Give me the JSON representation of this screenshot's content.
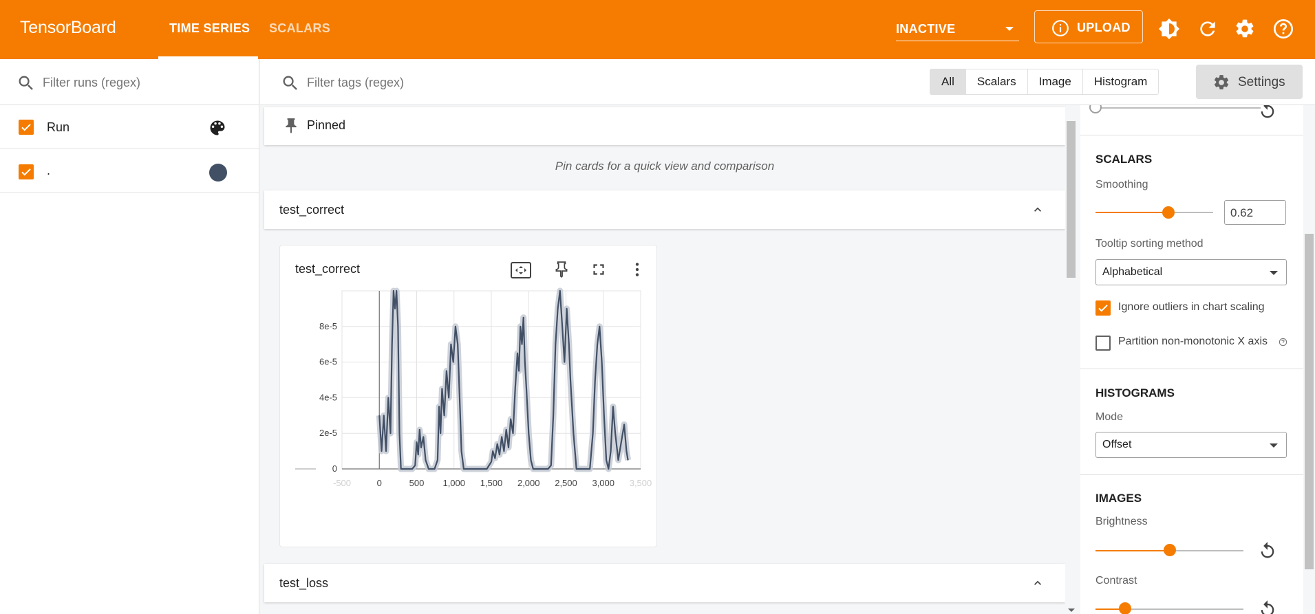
{
  "app": {
    "title": "TensorBoard",
    "accent": "#f57c00"
  },
  "nav": {
    "tabs": [
      {
        "label": "TIME SERIES",
        "active": true
      },
      {
        "label": "SCALARS",
        "active": false
      }
    ],
    "run_status": "INACTIVE",
    "upload_label": "UPLOAD",
    "icons": [
      "theme-icon",
      "reload-icon",
      "settings-icon",
      "help-icon"
    ]
  },
  "runs": {
    "filter_placeholder": "Filter runs (regex)",
    "items": [
      {
        "label": "Run",
        "checked": true,
        "icon": "palette-icon"
      },
      {
        "label": ".",
        "checked": true,
        "color": "#425066"
      }
    ]
  },
  "main": {
    "filter_placeholder": "Filter tags (regex)",
    "type_filters": [
      "All",
      "Scalars",
      "Image",
      "Histogram"
    ],
    "type_selected": "All",
    "settings_label": "Settings",
    "pinned": {
      "title": "Pinned",
      "empty_text": "Pin cards for a quick view and comparison"
    },
    "groups": [
      {
        "title": "test_correct",
        "expanded": true
      },
      {
        "title": "test_loss",
        "expanded": true
      }
    ]
  },
  "card": {
    "title": "test_correct",
    "icons": [
      "fit-domain-icon",
      "pin-icon",
      "fullscreen-icon",
      "more-vert-icon"
    ]
  },
  "chart_data": {
    "type": "line",
    "title": "test_correct",
    "xlabel": "",
    "ylabel": "",
    "x_ticks": [
      "0",
      "500",
      "1,000",
      "1,500",
      "2,000",
      "2,500",
      "3,000"
    ],
    "x_ticks_faded": [
      "-500",
      "3,500"
    ],
    "y_ticks": [
      "0",
      "2e-5",
      "4e-5",
      "6e-5",
      "8e-5"
    ],
    "xlim": [
      -500,
      3500
    ],
    "ylim": [
      0,
      0.0001
    ],
    "grid": true,
    "series": [
      {
        "smoothed": true,
        "color": "#425066",
        "x": [
          0,
          30,
          60,
          90,
          120,
          150,
          170,
          190,
          210,
          230,
          250,
          270,
          290,
          300,
          320,
          360,
          400,
          440,
          480,
          500,
          520,
          540,
          560,
          590,
          620,
          660,
          700,
          740,
          780,
          800,
          820,
          840,
          870,
          900,
          930,
          960,
          990,
          1020,
          1050,
          1080,
          1100,
          1130,
          1160,
          1200,
          1260,
          1320,
          1380,
          1440,
          1500,
          1520,
          1550,
          1580,
          1610,
          1640,
          1670,
          1700,
          1730,
          1760,
          1790,
          1820,
          1850,
          1870,
          1890,
          1910,
          1930,
          1950,
          1970,
          2000,
          2030,
          2060,
          2100,
          2160,
          2220,
          2260,
          2300,
          2330,
          2360,
          2390,
          2420,
          2450,
          2480,
          2510,
          2540,
          2560,
          2600,
          2640,
          2680,
          2720,
          2770,
          2820,
          2860,
          2890,
          2920,
          2950,
          2980,
          3010,
          3040,
          3070,
          3100,
          3130,
          3160,
          3200,
          3240,
          3280,
          3310,
          3330
        ],
        "y": [
          3e-05,
          1e-05,
          3e-05,
          1e-05,
          4e-05,
          2e-05,
          7e-05,
          0.0001,
          9e-05,
          0.0001,
          8e-05,
          2e-05,
          0,
          0,
          0,
          0,
          0,
          0,
          2e-06,
          1.5e-05,
          8e-06,
          2.2e-05,
          1.2e-05,
          1.8e-05,
          5e-06,
          0,
          0,
          0,
          5e-06,
          3.5e-05,
          2e-05,
          4.5e-05,
          3e-05,
          5.5e-05,
          4e-05,
          7e-05,
          6e-05,
          8e-05,
          7e-05,
          3.5e-05,
          1e-05,
          0,
          0,
          0,
          0,
          0,
          0,
          0,
          4e-06,
          1e-05,
          6e-06,
          1.4e-05,
          8e-06,
          1.8e-05,
          1e-05,
          2.2e-05,
          1.2e-05,
          2.8e-05,
          2e-05,
          4.5e-05,
          6.5e-05,
          5.5e-05,
          8e-05,
          7e-05,
          8.5e-05,
          6e-05,
          4.5e-05,
          2e-05,
          5e-06,
          0,
          0,
          0,
          0,
          0,
          2e-06,
          3e-05,
          7e-05,
          9e-05,
          0.0001,
          8e-05,
          6e-05,
          9e-05,
          7e-05,
          5e-05,
          2e-05,
          0,
          0,
          0,
          0,
          0,
          2e-05,
          5e-05,
          7e-05,
          8e-05,
          6e-05,
          3e-05,
          5e-06,
          0,
          1e-05,
          3.5e-05,
          2e-05,
          5e-06,
          1.5e-05,
          2.5e-05,
          1e-05,
          5e-06
        ]
      }
    ]
  },
  "settings_panel": {
    "scalars": {
      "title": "SCALARS",
      "smoothing_label": "Smoothing",
      "smoothing_value": "0.62",
      "smoothing": 0.62,
      "tooltip_label": "Tooltip sorting method",
      "tooltip_value": "Alphabetical",
      "ignore_outliers_label": "Ignore outliers in chart scaling",
      "ignore_outliers": true,
      "partition_label": "Partition non-monotonic X axis",
      "partition": false
    },
    "histograms": {
      "title": "HISTOGRAMS",
      "mode_label": "Mode",
      "mode_value": "Offset"
    },
    "images": {
      "title": "IMAGES",
      "brightness_label": "Brightness",
      "brightness": 0.5,
      "contrast_label": "Contrast",
      "contrast": 0.2
    }
  }
}
